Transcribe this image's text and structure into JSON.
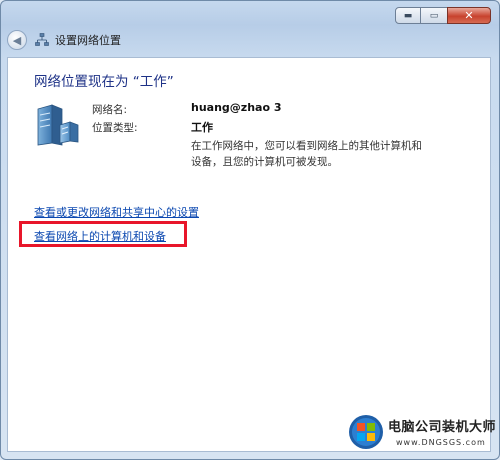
{
  "window": {
    "nav_title": "设置网络位置",
    "buttons": {
      "min": "▬",
      "max": "▭",
      "close": "✕"
    }
  },
  "icons": {
    "back": "back-arrow-icon",
    "network": "network-icon",
    "server": "server-icon"
  },
  "main": {
    "heading": "网络位置现在为 “工作”",
    "network_name_label": "网络名:",
    "network_name_value": "huang@zhao  3",
    "location_type_label": "位置类型:",
    "location_type_value": "工作",
    "description": "在工作网络中，您可以看到网络上的其他计算机和设备，且您的计算机可被发现。",
    "links": {
      "sharing_center": "查看或更改网络和共享中心的设置",
      "view_computers": "查看网络上的计算机和设备"
    }
  },
  "watermark": {
    "title": "电脑公司装机大师",
    "url": "www.DNGSGS.com"
  },
  "colors": {
    "link": "#0a47b0",
    "heading": "#1e3287",
    "highlight": "#e8162a"
  }
}
